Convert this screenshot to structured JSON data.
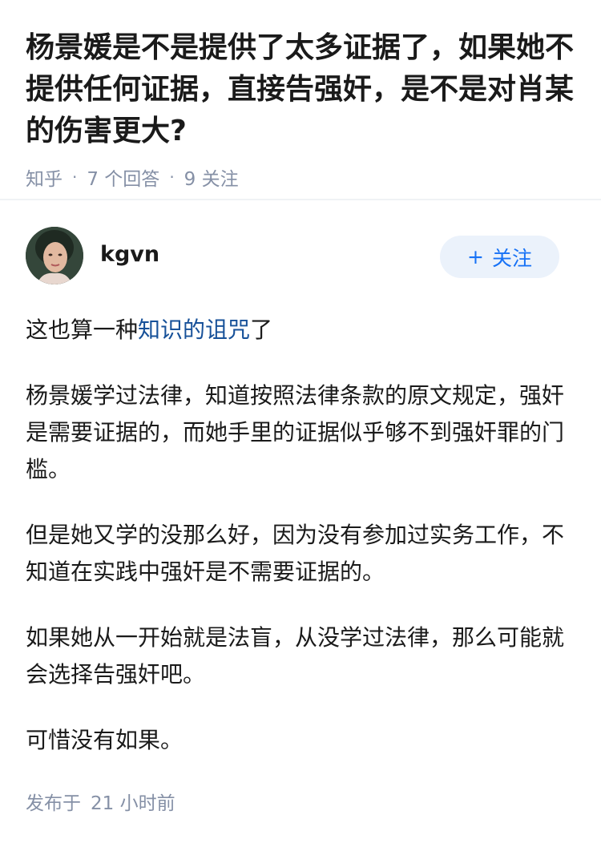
{
  "question": {
    "title": "杨景媛是不是提供了太多证据了，如果她不提供任何证据，直接告强奸，是不是对肖某的伤害更大?",
    "source": "知乎",
    "answers_count": "7 个回答",
    "followers_count": "9 关注"
  },
  "answer": {
    "author": {
      "name": "kgvn",
      "follow_label": "关注",
      "follow_icon": "plus-icon"
    },
    "paragraphs": {
      "p1_prefix": "这也算一种",
      "p1_link": "知识的诅咒",
      "p1_suffix": "了",
      "p2": "杨景媛学过法律，知道按照法律条款的原文规定，强奸是需要证据的，而她手里的证据似乎够不到强奸罪的门槛。",
      "p3": "但是她又学的没那么好，因为没有参加过实务工作，不知道在实践中强奸是不需要证据的。",
      "p4": "如果她从一开始就是法盲，从没学过法律，那么可能就会选择告强奸吧。",
      "p5": "可惜没有如果。"
    },
    "published_label": "发布于",
    "published_time": "21 小时前"
  },
  "colors": {
    "link": "#175199",
    "accent": "#1772f6",
    "follow_bg": "#ebf2fb",
    "meta": "#8590a6"
  }
}
